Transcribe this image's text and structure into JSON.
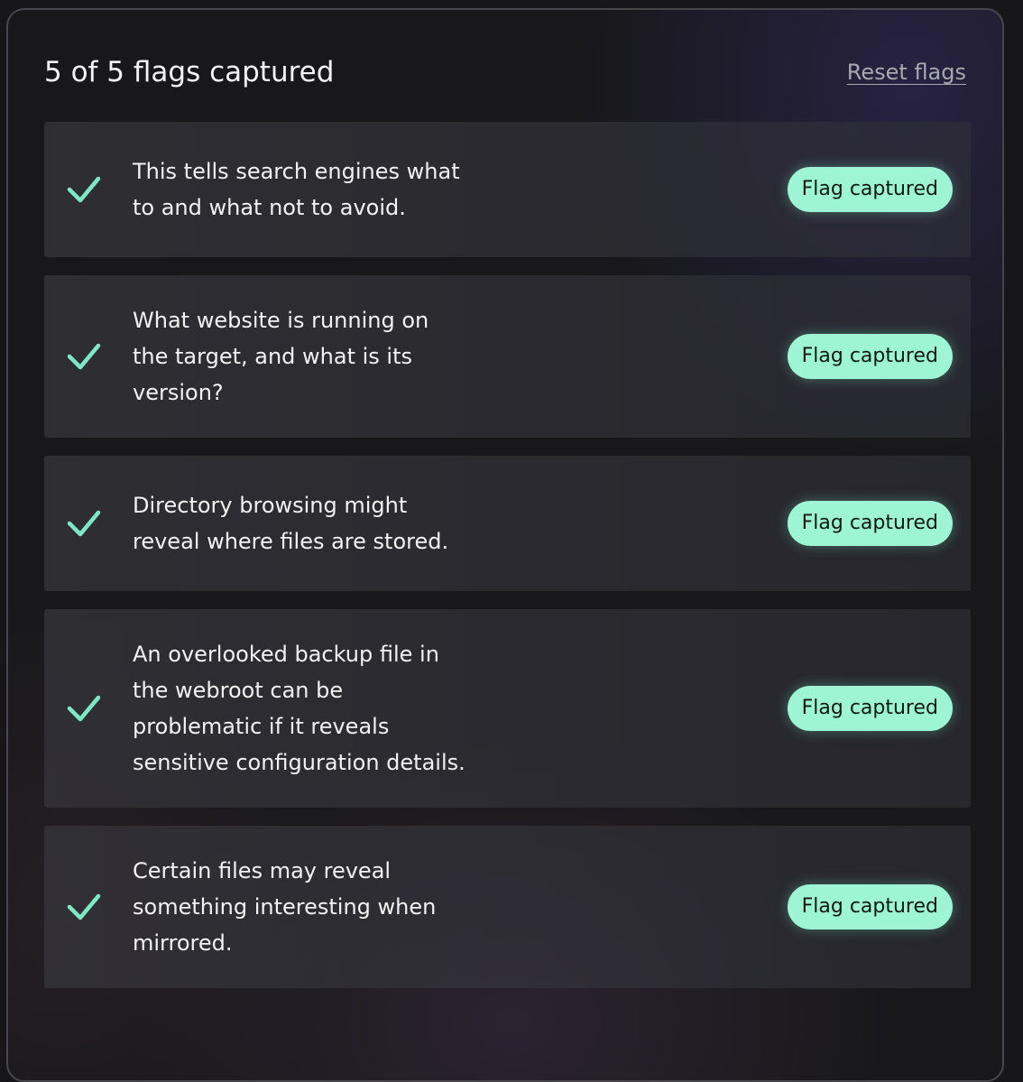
{
  "header": {
    "title": "5 of 5 flags captured",
    "reset_label": "Reset flags"
  },
  "colors": {
    "accent": "#9df5d6",
    "check": "#7ee8c4"
  },
  "flags": [
    {
      "lines": [
        "This tells search engines what",
        "to and what not to avoid."
      ],
      "status": "Flag captured",
      "icon": "checkmark-icon"
    },
    {
      "lines": [
        "What website is running on",
        "the target, and what is its",
        "version?"
      ],
      "status": "Flag captured",
      "icon": "checkmark-icon"
    },
    {
      "lines": [
        "Directory browsing might",
        "reveal where files are stored."
      ],
      "status": "Flag captured",
      "icon": "checkmark-icon"
    },
    {
      "lines": [
        "An overlooked backup file in",
        "the webroot can be",
        "problematic if it reveals",
        "sensitive configuration details."
      ],
      "status": "Flag captured",
      "icon": "checkmark-icon"
    },
    {
      "lines": [
        "Certain files may reveal",
        "something interesting when",
        "mirrored."
      ],
      "status": "Flag captured",
      "icon": "checkmark-icon"
    }
  ]
}
